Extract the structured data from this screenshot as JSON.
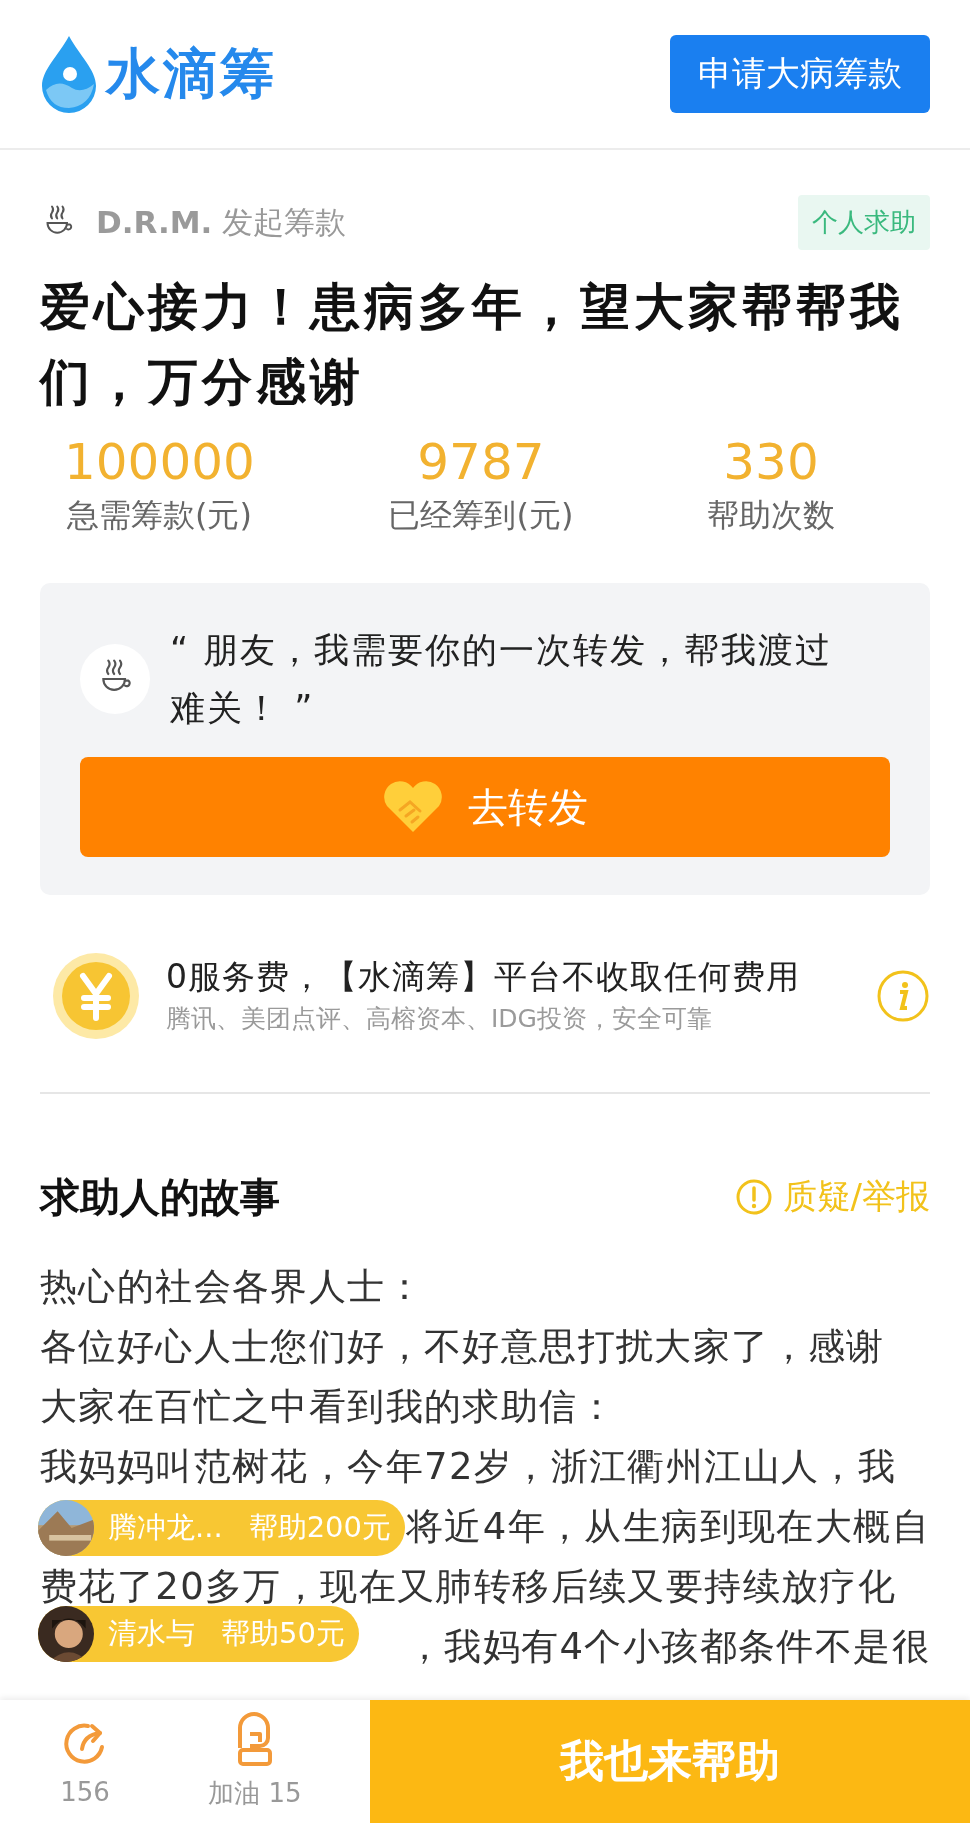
{
  "header": {
    "logo_text": "水滴筹",
    "apply_button": "申请大病筹款"
  },
  "campaign": {
    "creator": "D.R.M.",
    "creator_action": "发起筹款",
    "tag": "个人求助",
    "title": "爱心接力！患病多年，望大家帮帮我们，万分感谢"
  },
  "stats": [
    {
      "value": "100000",
      "label": "急需筹款(元)"
    },
    {
      "value": "9787",
      "label": "已经筹到(元)"
    },
    {
      "value": "330",
      "label": "帮助次数"
    }
  ],
  "share_card": {
    "quote": "“ 朋友，我需要你的一次转发，帮我渡过难关！ ”",
    "button": "去转发"
  },
  "fee_notice": {
    "title": "0服务费，【水滴筹】平台不收取任何费用",
    "subtitle": "腾讯、美团点评、高榕资本、IDG投资，安全可靠"
  },
  "story": {
    "heading": "求助人的故事",
    "report_link": "质疑/举报",
    "lines": [
      {
        "kind": "full",
        "text": "热心的社会各界人士："
      },
      {
        "kind": "full",
        "text": "各位好心人士您们好，不好意思打扰大家了，感谢"
      },
      {
        "kind": "full",
        "text": "大家在百忙之中看到我的求助信："
      },
      {
        "kind": "full",
        "text": "我妈妈叫范树花，今年72岁，浙江衢州江山人，我"
      },
      {
        "kind": "tail",
        "text": "将近4年，从生病到现在大概自"
      },
      {
        "kind": "full",
        "text": "费花了20多万，现在又肺转移后续又要持续放疗化"
      },
      {
        "kind": "tail",
        "text": "，我妈有4个小孩都条件不是很"
      }
    ]
  },
  "donations": [
    {
      "name": "腾冲龙...",
      "amount": "帮助200元"
    },
    {
      "name": "清水与",
      "amount": "帮助50元"
    }
  ],
  "bottom_bar": {
    "share_count": "156",
    "cheer_label": "加油 15",
    "help_button": "我也来帮助"
  }
}
